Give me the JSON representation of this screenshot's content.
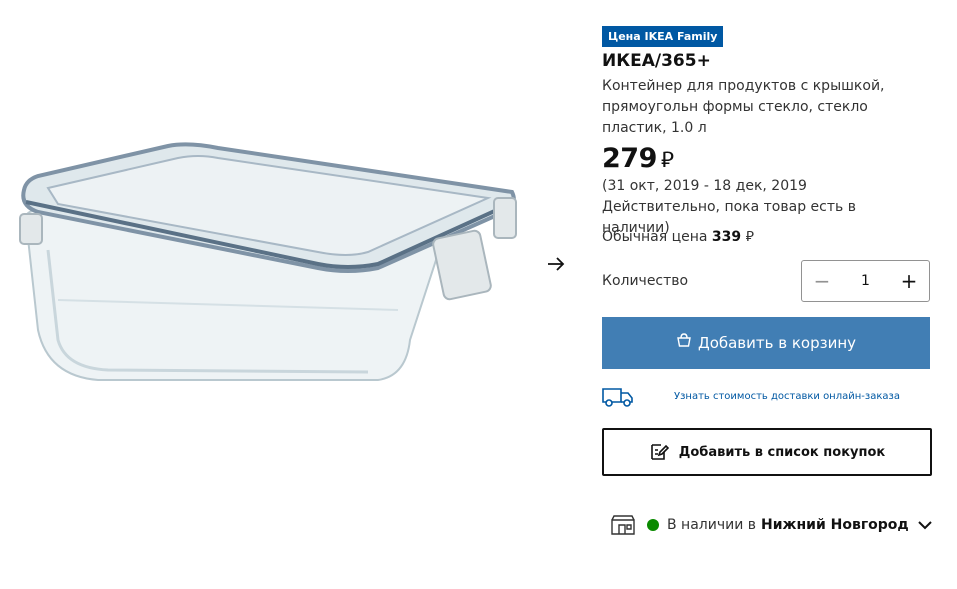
{
  "badge": "Цена IKEA Family",
  "product": {
    "name": "ИКЕА/365+",
    "description": "Контейнер для продуктов с крышкой, прямоугольн формы стекло, стекло пластик, 1.0 л",
    "price": "279",
    "currency_symbol": "⃏",
    "validity": "(31 окт, 2019 - 18 дек, 2019 Действительно, пока товар есть в наличии)",
    "regular_price_label": "Обычная цена",
    "regular_price": "339",
    "image_icon": "glass-food-container"
  },
  "quantity": {
    "label": "Количество",
    "value": "1",
    "decrement": "−",
    "increment": "+"
  },
  "buttons": {
    "add_to_cart": "Добавить в корзину",
    "add_to_list": "Добавить в список покупок"
  },
  "delivery": {
    "link": "Узнать стоимость доставки онлайн-заказа",
    "icon": "truck-icon"
  },
  "stock": {
    "prefix": "В наличии в",
    "store": "Нижний Новгород",
    "status_color": "#0a8a00"
  },
  "colors": {
    "badge": "#0058a3",
    "primary_button": "#417eb4"
  }
}
